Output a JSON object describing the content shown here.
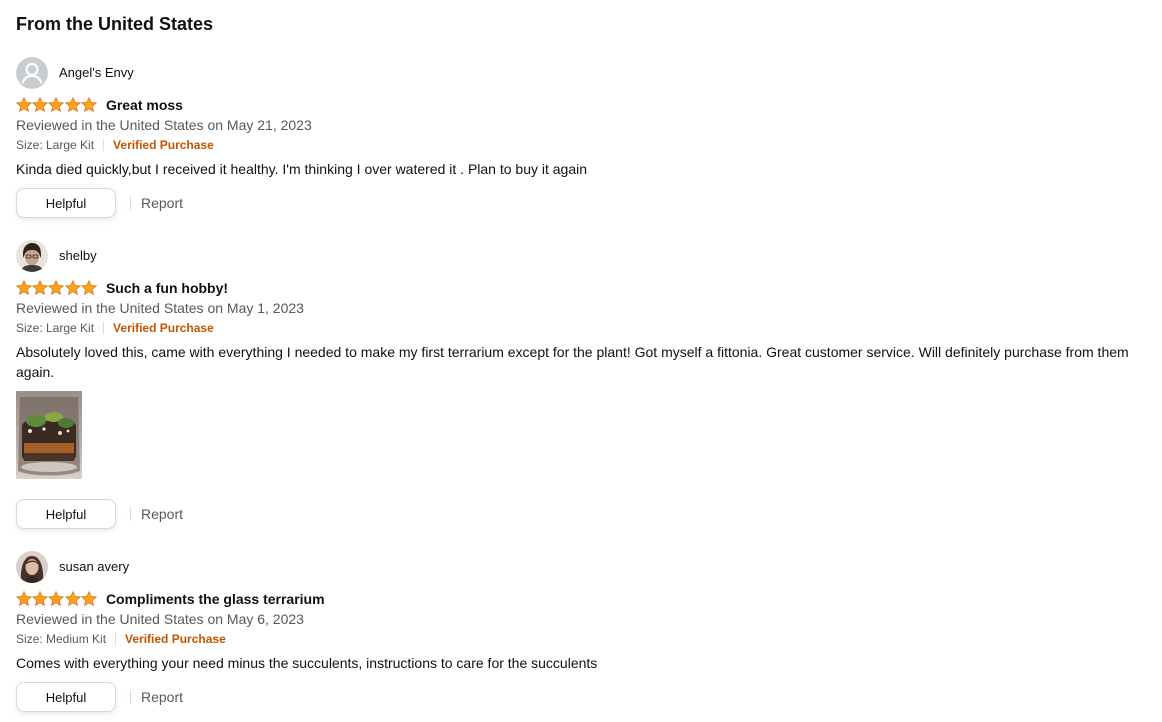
{
  "section_title": "From the United States",
  "colors": {
    "star": "#FFA41C",
    "star_stroke": "#DE7921",
    "verified": "#C45500",
    "muted": "#565959"
  },
  "reviews": [
    {
      "reviewer": "Angel's Envy",
      "avatar": "default-avatar-icon",
      "rating": 5,
      "title": "Great moss",
      "date": "Reviewed in the United States on May 21, 2023",
      "size": "Size: Large Kit",
      "verified": "Verified Purchase",
      "body": "Kinda died quickly,but I received it healthy. I'm thinking I over watered it . Plan to buy it again",
      "helpful": "Helpful",
      "report": "Report"
    },
    {
      "reviewer": "shelby",
      "avatar": "user-photo",
      "rating": 5,
      "title": "Such a fun hobby!",
      "date": "Reviewed in the United States on May 1, 2023",
      "size": "Size: Large Kit",
      "verified": "Verified Purchase",
      "body": "Absolutely loved this, came with everything I needed to make my first terrarium except for the plant! Got myself a fittonia. Great customer service. Will definitely purchase from them again.",
      "has_image": true,
      "helpful": "Helpful",
      "report": "Report"
    },
    {
      "reviewer": "susan avery",
      "avatar": "user-photo",
      "rating": 5,
      "title": "Compliments the glass terrarium",
      "date": "Reviewed in the United States on May 6, 2023",
      "size": "Size: Medium Kit",
      "verified": "Verified Purchase",
      "body": "Comes with everything your need minus the succulents, instructions to care for the succulents",
      "helpful": "Helpful",
      "report": "Report"
    }
  ]
}
